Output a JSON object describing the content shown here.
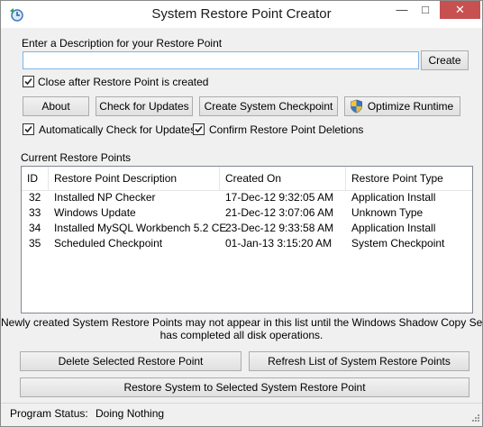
{
  "window": {
    "title": "System Restore Point Creator",
    "controls": {
      "minimize": "—",
      "maximize": "□",
      "close": "✕"
    }
  },
  "description": {
    "label": "Enter a Description for your Restore Point",
    "value": "",
    "create_button": "Create"
  },
  "options": {
    "close_after": {
      "label": "Close after Restore Point is created",
      "checked": true
    },
    "auto_check": {
      "label": "Automatically Check for Updates",
      "checked": true
    },
    "confirm_delete": {
      "label": "Confirm Restore Point Deletions",
      "checked": true
    }
  },
  "toolbar": {
    "about": "About",
    "check_updates": "Check for Updates",
    "create_checkpoint": "Create System Checkpoint",
    "optimize": "Optimize Runtime"
  },
  "restore_points": {
    "label": "Current Restore Points",
    "columns": [
      "ID",
      "Restore Point Description",
      "Created On",
      "Restore Point Type"
    ],
    "rows": [
      [
        "32",
        "Installed NP Checker",
        "17-Dec-12 9:32:05 AM",
        "Application Install"
      ],
      [
        "33",
        "Windows Update",
        "21-Dec-12 3:07:06 AM",
        "Unknown Type"
      ],
      [
        "34",
        "Installed MySQL Workbench 5.2 CE",
        "23-Dec-12 9:33:58 AM",
        "Application Install"
      ],
      [
        "35",
        "Scheduled Checkpoint",
        "01-Jan-13 3:15:20 AM",
        "System Checkpoint"
      ]
    ]
  },
  "notice": {
    "line1": "Newly created System Restore Points may not appear in this list until the Windows Shadow Copy Service",
    "line2": "has completed all disk operations."
  },
  "actions": {
    "delete": "Delete Selected Restore Point",
    "refresh": "Refresh List of System Restore Points",
    "restore": "Restore System to Selected System Restore Point"
  },
  "status": {
    "label": "Program Status:",
    "value": "Doing Nothing"
  },
  "colors": {
    "accent_border": "#7eb4ea",
    "close_red": "#c75050"
  }
}
